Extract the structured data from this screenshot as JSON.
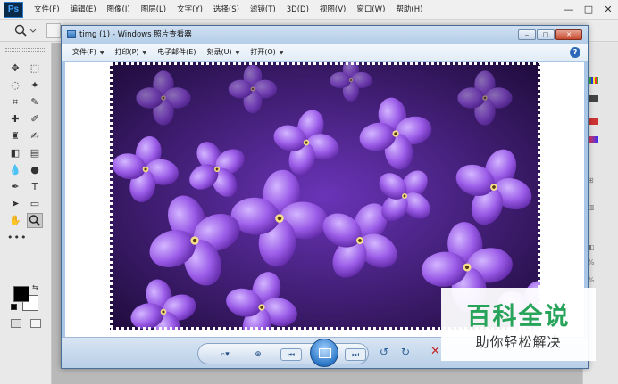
{
  "photoshop": {
    "logo": "Ps",
    "menu": [
      "文件(F)",
      "编辑(E)",
      "图像(I)",
      "图层(L)",
      "文字(Y)",
      "选择(S)",
      "滤镜(T)",
      "3D(D)",
      "视图(V)",
      "窗口(W)",
      "帮助(H)"
    ],
    "window_buttons": [
      "—",
      "□",
      "✕"
    ]
  },
  "photo_viewer": {
    "title": "timg (1) - Windows 照片查看器",
    "menu": [
      {
        "label": "文件(F)"
      },
      {
        "label": "打印(P)"
      },
      {
        "label": "电子邮件(E)"
      },
      {
        "label": "刻录(U)"
      },
      {
        "label": "打开(O)"
      }
    ],
    "help": "?",
    "image": {
      "subject": "purple lilac flowers with jagged frame edge",
      "dominant_color": "#7b3fc4"
    }
  },
  "watermark": {
    "title": "百科全说",
    "subtitle": "助你轻松解决"
  },
  "colors": {
    "ps_accent": "#44a4ff",
    "viewer_chrome": "#b4cde8",
    "watermark_green": "#27a45a",
    "flower_purple": "#8a4fe0"
  }
}
